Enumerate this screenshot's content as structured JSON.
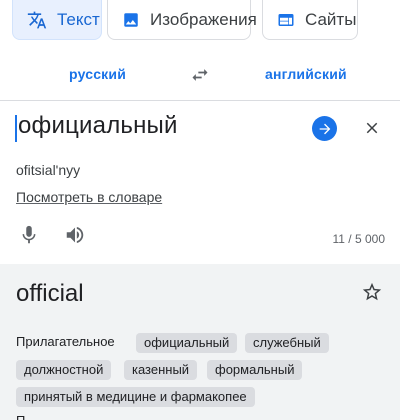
{
  "tabs": [
    {
      "label": "Текст",
      "icon": "translate-icon",
      "active": true
    },
    {
      "label": "Изображения",
      "icon": "image-icon",
      "active": false
    },
    {
      "label": "Сайты",
      "icon": "website-icon",
      "active": false
    }
  ],
  "languages": {
    "source": "русский",
    "target": "английский",
    "swap_icon": "swap-arrows-icon"
  },
  "input": {
    "text": "официальный",
    "transliteration": "ofitsial'nyy",
    "dictionary_link": "Посмотреть в словаре",
    "char_count": "11 / 5 000"
  },
  "output": {
    "text": "official",
    "part_of_speech": "Прилагательное",
    "synonyms": [
      "официальный",
      "служебный",
      "должностной",
      "казенный",
      "формальный",
      "принятый в медицине и фармакопее"
    ],
    "next_partial": "П"
  },
  "colors": {
    "accent": "#1a73e8",
    "active_tab_bg": "#e8f0fe",
    "output_bg": "#f1f3f4",
    "chip_bg": "#dadce0"
  }
}
